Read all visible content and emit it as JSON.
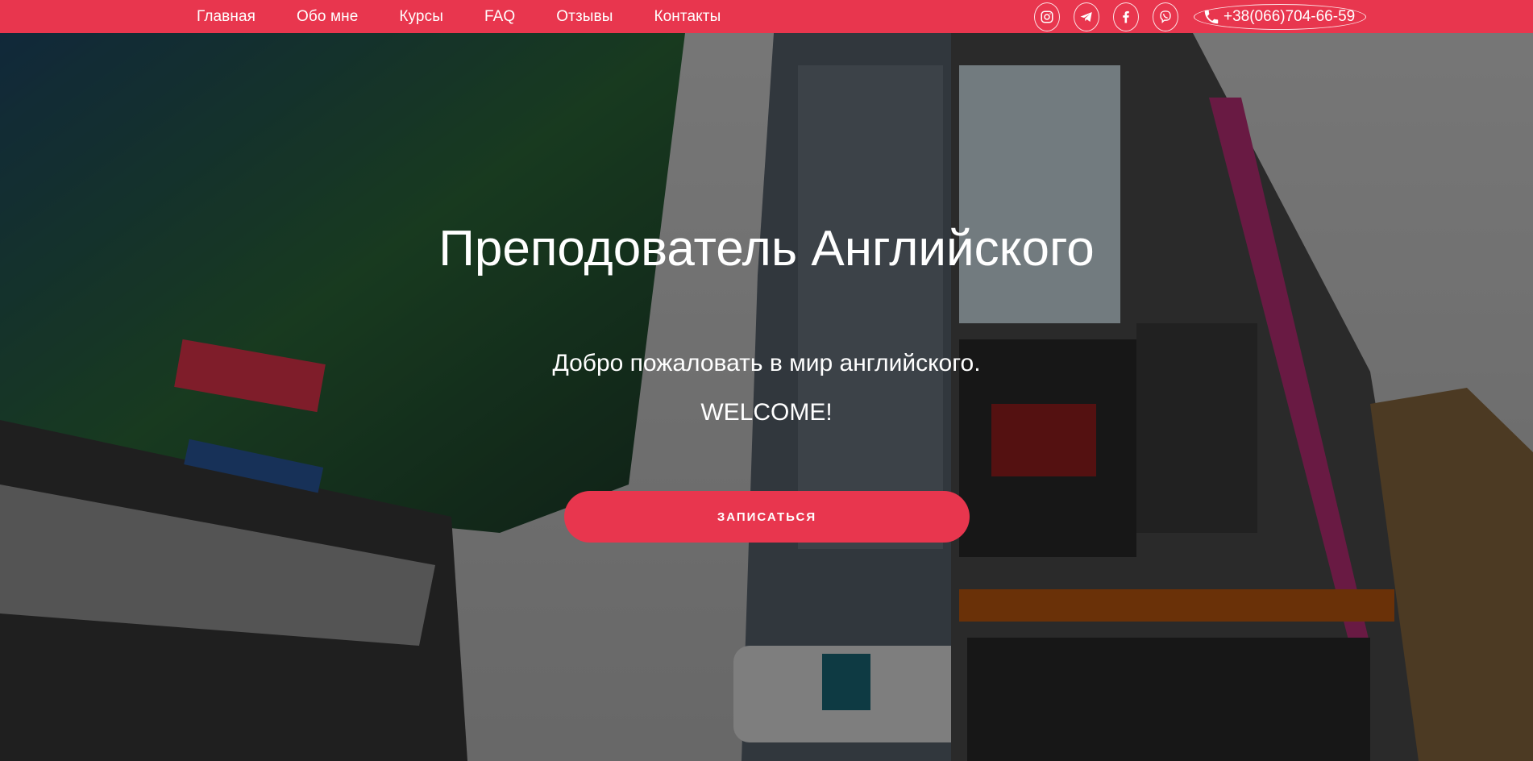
{
  "nav": {
    "items": [
      {
        "label": "Главная"
      },
      {
        "label": "Обо мне"
      },
      {
        "label": "Курсы"
      },
      {
        "label": "FAQ"
      },
      {
        "label": "Отзывы"
      },
      {
        "label": "Контакты"
      }
    ]
  },
  "socials": {
    "icons": [
      "instagram-icon",
      "telegram-icon",
      "facebook-icon",
      "viber-icon"
    ],
    "phone": "+38(066)704-66-59"
  },
  "hero": {
    "title": "Преподователь Английского",
    "subtitle": "Добро пожаловать в мир английского.",
    "welcome": "WELCOME!",
    "cta_label": "ЗАПИСАТЬСЯ"
  },
  "colors": {
    "accent": "#e8364e",
    "text": "#ffffff"
  }
}
